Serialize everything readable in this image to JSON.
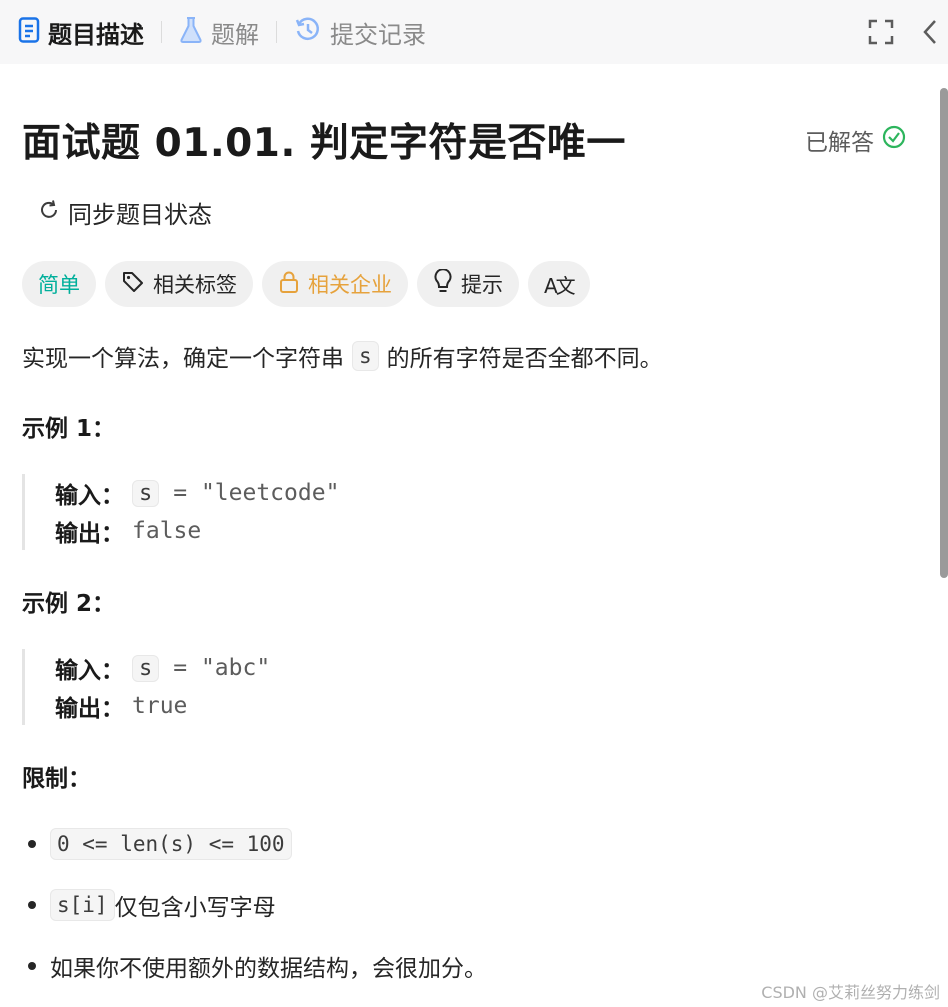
{
  "tabs": [
    {
      "label": "题目描述",
      "icon": "document-icon",
      "active": true
    },
    {
      "label": "题解",
      "icon": "flask-icon",
      "active": false
    },
    {
      "label": "提交记录",
      "icon": "history-icon",
      "active": false
    }
  ],
  "toolbar": {
    "fullscreen_icon": "fullscreen-icon",
    "collapse_icon": "chevron-left-icon"
  },
  "problem": {
    "title": "面试题 01.01. 判定字符是否唯一",
    "status": "已解答",
    "sync_label": "同步题目状态",
    "chips": {
      "difficulty": "简单",
      "tags": "相关标签",
      "company": "相关企业",
      "hint": "提示",
      "translate": "A文"
    },
    "description": {
      "before": "实现一个算法，确定一个字符串",
      "code": "s",
      "after": "的所有字符是否全都不同。"
    },
    "examples": [
      {
        "heading": "示例 1：",
        "input_label": "输入：",
        "input_var": "s",
        "input_rest": "= \"leetcode\"",
        "output_label": "输出：",
        "output": "false"
      },
      {
        "heading": "示例 2：",
        "input_label": "输入：",
        "input_var": "s",
        "input_rest": "= \"abc\"",
        "output_label": "输出：",
        "output": "true"
      }
    ],
    "constraints_heading": "限制：",
    "constraints": [
      {
        "code": "0 <= len(s) <= 100",
        "text": ""
      },
      {
        "code": "s[i]",
        "text": "仅包含小写字母"
      },
      {
        "code": "",
        "text": "如果你不使用额外的数据结构，会很加分。"
      }
    ]
  },
  "colors": {
    "easy": "#00af9b",
    "company": "#e6a23c",
    "solved_check": "#2db55d",
    "tab_icon_active": "#1a73e8",
    "tab_icon_inactive": "#8ab4f8"
  },
  "watermark": "CSDN @艾莉丝努力练剑"
}
